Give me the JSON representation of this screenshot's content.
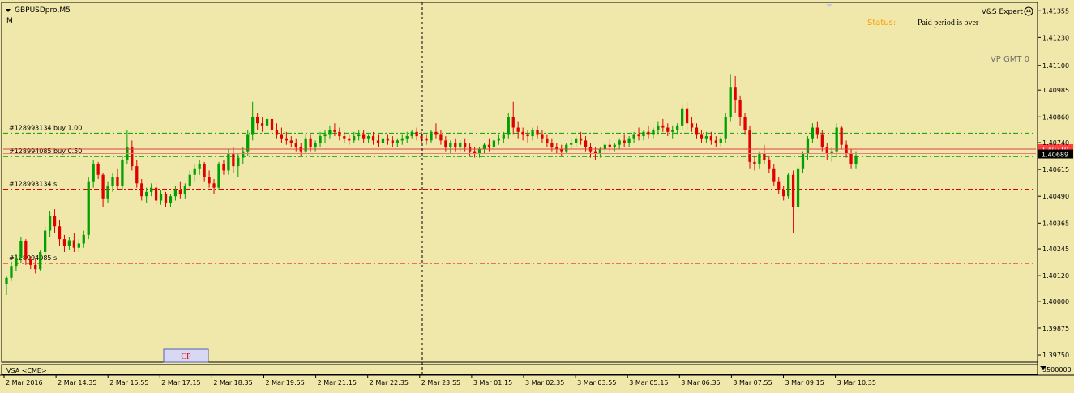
{
  "chart_header": {
    "symbol": "GBPUSDpro,M5",
    "mode": "M"
  },
  "expert": {
    "name": "V&S Expert",
    "status_label": "Status:",
    "status_value": "Paid period is over",
    "vp_label": "VP GMT 0"
  },
  "indicator_bar": {
    "label": "VSA <CME>",
    "scale_value": "9500000"
  },
  "cp_button": {
    "label": "CP"
  },
  "order_labels": [
    {
      "text": "#128993134 buy 1.00",
      "price": 1.40784,
      "color": "#00a000",
      "style": "dashdot"
    },
    {
      "text": "#128994085 buy 0.50",
      "price": 1.40675,
      "color": "#00a000",
      "style": "dashdot"
    },
    {
      "text": "#128993134 sl",
      "price": 1.40523,
      "color": "#e00000",
      "style": "dashdot"
    },
    {
      "text": "#128994085 sl",
      "price": 1.40177,
      "color": "#e00000",
      "style": "dashdot"
    }
  ],
  "chart_data": {
    "type": "candlestick",
    "symbol": "GBPUSDpro",
    "timeframe": "M5",
    "y_ticks": [
      "1.41355",
      "1.41230",
      "1.41100",
      "1.40985",
      "1.40860",
      "1.40740",
      "1.40615",
      "1.40490",
      "1.40365",
      "1.40245",
      "1.40120",
      "1.40000",
      "1.39875",
      "1.39750"
    ],
    "ylim": [
      1.3972,
      1.4139
    ],
    "x_ticks": [
      "2 Mar 2016",
      "2 Mar 14:35",
      "2 Mar 15:55",
      "2 Mar 17:15",
      "2 Mar 18:35",
      "2 Mar 19:55",
      "2 Mar 21:15",
      "2 Mar 22:35",
      "2 Mar 23:55",
      "3 Mar 01:15",
      "3 Mar 02:35",
      "3 Mar 03:55",
      "3 Mar 05:15",
      "3 Mar 06:35",
      "3 Mar 07:55",
      "3 Mar 09:15",
      "3 Mar 10:35"
    ],
    "current_price": "1.40689",
    "current_price_value": 1.40689,
    "ask_price_value": 1.4071,
    "ask_price_label": "1.40710",
    "colors": {
      "bull": "#00a000",
      "bear": "#e00000",
      "price_line": "#e08080",
      "background": "#f0e8aa"
    },
    "bars": [
      [
        1.4008,
        1.4012,
        1.4003,
        1.4011
      ],
      [
        1.4011,
        1.40185,
        1.40095,
        1.40165
      ],
      [
        1.40165,
        1.4022,
        1.4014,
        1.402
      ],
      [
        1.402,
        1.403,
        1.4018,
        1.4028
      ],
      [
        1.4028,
        1.4029,
        1.4017,
        1.40195
      ],
      [
        1.40195,
        1.4021,
        1.4015,
        1.4017
      ],
      [
        1.4017,
        1.402,
        1.4013,
        1.4015
      ],
      [
        1.4015,
        1.4024,
        1.4014,
        1.4023
      ],
      [
        1.4023,
        1.4035,
        1.402,
        1.4033
      ],
      [
        1.4033,
        1.4042,
        1.403,
        1.404
      ],
      [
        1.404,
        1.4043,
        1.4032,
        1.4035
      ],
      [
        1.4035,
        1.4038,
        1.4026,
        1.4029
      ],
      [
        1.4029,
        1.4031,
        1.4023,
        1.4026
      ],
      [
        1.4026,
        1.403,
        1.4024,
        1.40285
      ],
      [
        1.40285,
        1.4032,
        1.4023,
        1.4025
      ],
      [
        1.4025,
        1.4029,
        1.4023,
        1.4027
      ],
      [
        1.4027,
        1.4033,
        1.4025,
        1.4031
      ],
      [
        1.4031,
        1.4058,
        1.4029,
        1.4056
      ],
      [
        1.4056,
        1.4066,
        1.4053,
        1.4064
      ],
      [
        1.4064,
        1.4065,
        1.4057,
        1.4059
      ],
      [
        1.4059,
        1.406,
        1.4044,
        1.4048
      ],
      [
        1.4048,
        1.4056,
        1.4046,
        1.4054
      ],
      [
        1.4054,
        1.406,
        1.4051,
        1.4058
      ],
      [
        1.4058,
        1.4062,
        1.4052,
        1.4054
      ],
      [
        1.4054,
        1.4068,
        1.4052,
        1.4066
      ],
      [
        1.4066,
        1.408,
        1.4064,
        1.4072
      ],
      [
        1.4072,
        1.4075,
        1.4061,
        1.4063
      ],
      [
        1.4063,
        1.4066,
        1.4053,
        1.4055
      ],
      [
        1.4055,
        1.4057,
        1.4047,
        1.4049
      ],
      [
        1.4049,
        1.4053,
        1.4046,
        1.4051
      ],
      [
        1.4051,
        1.4055,
        1.4049,
        1.4053
      ],
      [
        1.4053,
        1.4056,
        1.4045,
        1.4047
      ],
      [
        1.4047,
        1.4052,
        1.4045,
        1.405
      ],
      [
        1.405,
        1.4051,
        1.4044,
        1.4046
      ],
      [
        1.4046,
        1.405,
        1.4044,
        1.4049
      ],
      [
        1.4049,
        1.4054,
        1.4047,
        1.4052
      ],
      [
        1.4052,
        1.4056,
        1.4048,
        1.405
      ],
      [
        1.405,
        1.4055,
        1.4048,
        1.4054
      ],
      [
        1.4054,
        1.4061,
        1.4052,
        1.4059
      ],
      [
        1.4059,
        1.4064,
        1.4056,
        1.4062
      ],
      [
        1.4062,
        1.4066,
        1.4059,
        1.4064
      ],
      [
        1.4064,
        1.4065,
        1.4056,
        1.4058
      ],
      [
        1.4058,
        1.4061,
        1.4053,
        1.4055
      ],
      [
        1.4055,
        1.4057,
        1.405,
        1.4053
      ],
      [
        1.4053,
        1.4065,
        1.4052,
        1.4064
      ],
      [
        1.4064,
        1.4066,
        1.4059,
        1.4061
      ],
      [
        1.4061,
        1.4071,
        1.4059,
        1.4069
      ],
      [
        1.4069,
        1.4072,
        1.406,
        1.4063
      ],
      [
        1.4063,
        1.4069,
        1.4058,
        1.4067
      ],
      [
        1.4067,
        1.4072,
        1.4064,
        1.407
      ],
      [
        1.407,
        1.408,
        1.4068,
        1.4078
      ],
      [
        1.4078,
        1.4093,
        1.4075,
        1.4086
      ],
      [
        1.4086,
        1.4088,
        1.408,
        1.4083
      ],
      [
        1.4083,
        1.4086,
        1.4079,
        1.4082
      ],
      [
        1.4082,
        1.4087,
        1.408,
        1.4085
      ],
      [
        1.4085,
        1.4086,
        1.4078,
        1.408
      ],
      [
        1.408,
        1.4083,
        1.4076,
        1.4078
      ],
      [
        1.4078,
        1.4081,
        1.4074,
        1.4076
      ],
      [
        1.4076,
        1.4079,
        1.4073,
        1.4075
      ],
      [
        1.4075,
        1.4077,
        1.4072,
        1.4074
      ],
      [
        1.4074,
        1.4076,
        1.407,
        1.4072
      ],
      [
        1.4072,
        1.4074,
        1.4068,
        1.407
      ],
      [
        1.407,
        1.4078,
        1.4069,
        1.4076
      ],
      [
        1.4076,
        1.4078,
        1.407,
        1.4072
      ],
      [
        1.4072,
        1.4075,
        1.407,
        1.4074
      ],
      [
        1.4074,
        1.4079,
        1.4072,
        1.4077
      ],
      [
        1.4077,
        1.408,
        1.4074,
        1.4078
      ],
      [
        1.4078,
        1.4082,
        1.4076,
        1.408
      ],
      [
        1.408,
        1.4083,
        1.4077,
        1.4079
      ],
      [
        1.4079,
        1.4081,
        1.4075,
        1.4077
      ],
      [
        1.4077,
        1.4079,
        1.4074,
        1.4076
      ],
      [
        1.4076,
        1.4078,
        1.4073,
        1.4075
      ],
      [
        1.4075,
        1.4079,
        1.4074,
        1.4077
      ],
      [
        1.4077,
        1.408,
        1.4075,
        1.4078
      ],
      [
        1.4078,
        1.408,
        1.4074,
        1.4076
      ],
      [
        1.4076,
        1.4078,
        1.4074,
        1.4077
      ],
      [
        1.4077,
        1.4079,
        1.4073,
        1.4075
      ],
      [
        1.4075,
        1.4078,
        1.4072,
        1.4074
      ],
      [
        1.4074,
        1.4077,
        1.4072,
        1.4076
      ],
      [
        1.4076,
        1.4078,
        1.4073,
        1.4075
      ],
      [
        1.4075,
        1.4077,
        1.4072,
        1.4074
      ],
      [
        1.4074,
        1.4076,
        1.4072,
        1.4075
      ],
      [
        1.4075,
        1.4078,
        1.4073,
        1.4076
      ],
      [
        1.4076,
        1.4079,
        1.4074,
        1.4077
      ],
      [
        1.4077,
        1.408,
        1.4076,
        1.4079
      ],
      [
        1.4079,
        1.4081,
        1.4075,
        1.4077
      ],
      [
        1.4077,
        1.4079,
        1.4074,
        1.4076
      ],
      [
        1.4076,
        1.4078,
        1.4073,
        1.4075
      ],
      [
        1.4075,
        1.408,
        1.4074,
        1.4079
      ],
      [
        1.4079,
        1.4083,
        1.4076,
        1.4078
      ],
      [
        1.4078,
        1.408,
        1.4073,
        1.4075
      ],
      [
        1.4075,
        1.4077,
        1.407,
        1.4072
      ],
      [
        1.4072,
        1.4075,
        1.4069,
        1.4074
      ],
      [
        1.4074,
        1.4076,
        1.407,
        1.4072
      ],
      [
        1.4072,
        1.4075,
        1.407,
        1.4074
      ],
      [
        1.4074,
        1.4076,
        1.407,
        1.4072
      ],
      [
        1.4072,
        1.4074,
        1.4068,
        1.407
      ],
      [
        1.407,
        1.4072,
        1.4067,
        1.4069
      ],
      [
        1.4069,
        1.4072,
        1.4067,
        1.4071
      ],
      [
        1.4071,
        1.4074,
        1.4069,
        1.4073
      ],
      [
        1.4073,
        1.4076,
        1.407,
        1.4072
      ],
      [
        1.4072,
        1.4076,
        1.407,
        1.4075
      ],
      [
        1.4075,
        1.4078,
        1.4073,
        1.4076
      ],
      [
        1.4076,
        1.4079,
        1.4074,
        1.4078
      ],
      [
        1.4078,
        1.4088,
        1.4076,
        1.4086
      ],
      [
        1.4086,
        1.4093,
        1.4078,
        1.4081
      ],
      [
        1.4081,
        1.4084,
        1.4076,
        1.4079
      ],
      [
        1.4079,
        1.4081,
        1.4075,
        1.4078
      ],
      [
        1.4078,
        1.408,
        1.4074,
        1.4077
      ],
      [
        1.4077,
        1.4081,
        1.4075,
        1.408
      ],
      [
        1.408,
        1.4082,
        1.4076,
        1.4078
      ],
      [
        1.4078,
        1.408,
        1.4074,
        1.4076
      ],
      [
        1.4076,
        1.4078,
        1.4072,
        1.4074
      ],
      [
        1.4074,
        1.4076,
        1.407,
        1.4072
      ],
      [
        1.4072,
        1.4074,
        1.4069,
        1.4071
      ],
      [
        1.4071,
        1.4073,
        1.4068,
        1.407
      ],
      [
        1.407,
        1.4074,
        1.4069,
        1.4073
      ],
      [
        1.4073,
        1.4076,
        1.4071,
        1.4074
      ],
      [
        1.4074,
        1.4077,
        1.4072,
        1.4076
      ],
      [
        1.4076,
        1.4079,
        1.4073,
        1.4075
      ],
      [
        1.4075,
        1.4077,
        1.407,
        1.4072
      ],
      [
        1.4072,
        1.4074,
        1.4067,
        1.407
      ],
      [
        1.407,
        1.4072,
        1.4066,
        1.4069
      ],
      [
        1.4069,
        1.4072,
        1.4067,
        1.4071
      ],
      [
        1.4071,
        1.4074,
        1.4069,
        1.4073
      ],
      [
        1.4073,
        1.4076,
        1.407,
        1.4072
      ],
      [
        1.4072,
        1.4074,
        1.407,
        1.4073
      ],
      [
        1.4073,
        1.4076,
        1.4071,
        1.4075
      ],
      [
        1.4075,
        1.4078,
        1.4072,
        1.4074
      ],
      [
        1.4074,
        1.4077,
        1.4072,
        1.4076
      ],
      [
        1.4076,
        1.4079,
        1.4074,
        1.4078
      ],
      [
        1.4078,
        1.4081,
        1.4075,
        1.4077
      ],
      [
        1.4077,
        1.408,
        1.4075,
        1.4079
      ],
      [
        1.4079,
        1.4082,
        1.4076,
        1.4078
      ],
      [
        1.4078,
        1.4081,
        1.4076,
        1.408
      ],
      [
        1.408,
        1.4084,
        1.4078,
        1.4082
      ],
      [
        1.4082,
        1.4085,
        1.4079,
        1.4081
      ],
      [
        1.4081,
        1.4083,
        1.4077,
        1.4079
      ],
      [
        1.4079,
        1.4082,
        1.4076,
        1.408
      ],
      [
        1.408,
        1.4083,
        1.4078,
        1.4082
      ],
      [
        1.4082,
        1.4092,
        1.408,
        1.409
      ],
      [
        1.409,
        1.4093,
        1.408,
        1.4083
      ],
      [
        1.4083,
        1.4086,
        1.4079,
        1.4081
      ],
      [
        1.4081,
        1.4083,
        1.4076,
        1.4078
      ],
      [
        1.4078,
        1.408,
        1.4074,
        1.4076
      ],
      [
        1.4076,
        1.4079,
        1.4074,
        1.4077
      ],
      [
        1.4077,
        1.4079,
        1.4073,
        1.4075
      ],
      [
        1.4075,
        1.4077,
        1.4072,
        1.4074
      ],
      [
        1.4074,
        1.4077,
        1.4072,
        1.4076
      ],
      [
        1.4076,
        1.4088,
        1.4074,
        1.4086
      ],
      [
        1.4086,
        1.4106,
        1.4084,
        1.41
      ],
      [
        1.41,
        1.4105,
        1.4088,
        1.4094
      ],
      [
        1.4094,
        1.4096,
        1.4082,
        1.4086
      ],
      [
        1.4086,
        1.4088,
        1.4078,
        1.408
      ],
      [
        1.408,
        1.4082,
        1.4062,
        1.4065
      ],
      [
        1.4065,
        1.4068,
        1.4061,
        1.4064
      ],
      [
        1.4064,
        1.407,
        1.4062,
        1.4069
      ],
      [
        1.4069,
        1.4073,
        1.4064,
        1.4066
      ],
      [
        1.4066,
        1.4068,
        1.406,
        1.4062
      ],
      [
        1.4062,
        1.4064,
        1.4054,
        1.4056
      ],
      [
        1.4056,
        1.4058,
        1.405,
        1.4052
      ],
      [
        1.4052,
        1.4054,
        1.4047,
        1.4049
      ],
      [
        1.4049,
        1.406,
        1.4048,
        1.4059
      ],
      [
        1.4059,
        1.4061,
        1.4032,
        1.4044
      ],
      [
        1.4044,
        1.4064,
        1.4042,
        1.4062
      ],
      [
        1.4062,
        1.407,
        1.406,
        1.4069
      ],
      [
        1.4069,
        1.4077,
        1.4066,
        1.4076
      ],
      [
        1.4076,
        1.4083,
        1.4074,
        1.4081
      ],
      [
        1.4081,
        1.4084,
        1.4076,
        1.4078
      ],
      [
        1.4078,
        1.408,
        1.407,
        1.4072
      ],
      [
        1.4072,
        1.4074,
        1.4066,
        1.4069
      ],
      [
        1.4069,
        1.4072,
        1.4065,
        1.407
      ],
      [
        1.407,
        1.4083,
        1.4068,
        1.4081
      ],
      [
        1.4081,
        1.4082,
        1.4071,
        1.4073
      ],
      [
        1.4073,
        1.4075,
        1.4067,
        1.4069
      ],
      [
        1.4069,
        1.4071,
        1.4062,
        1.4064
      ],
      [
        1.4064,
        1.407,
        1.4062,
        1.4068
      ]
    ]
  }
}
